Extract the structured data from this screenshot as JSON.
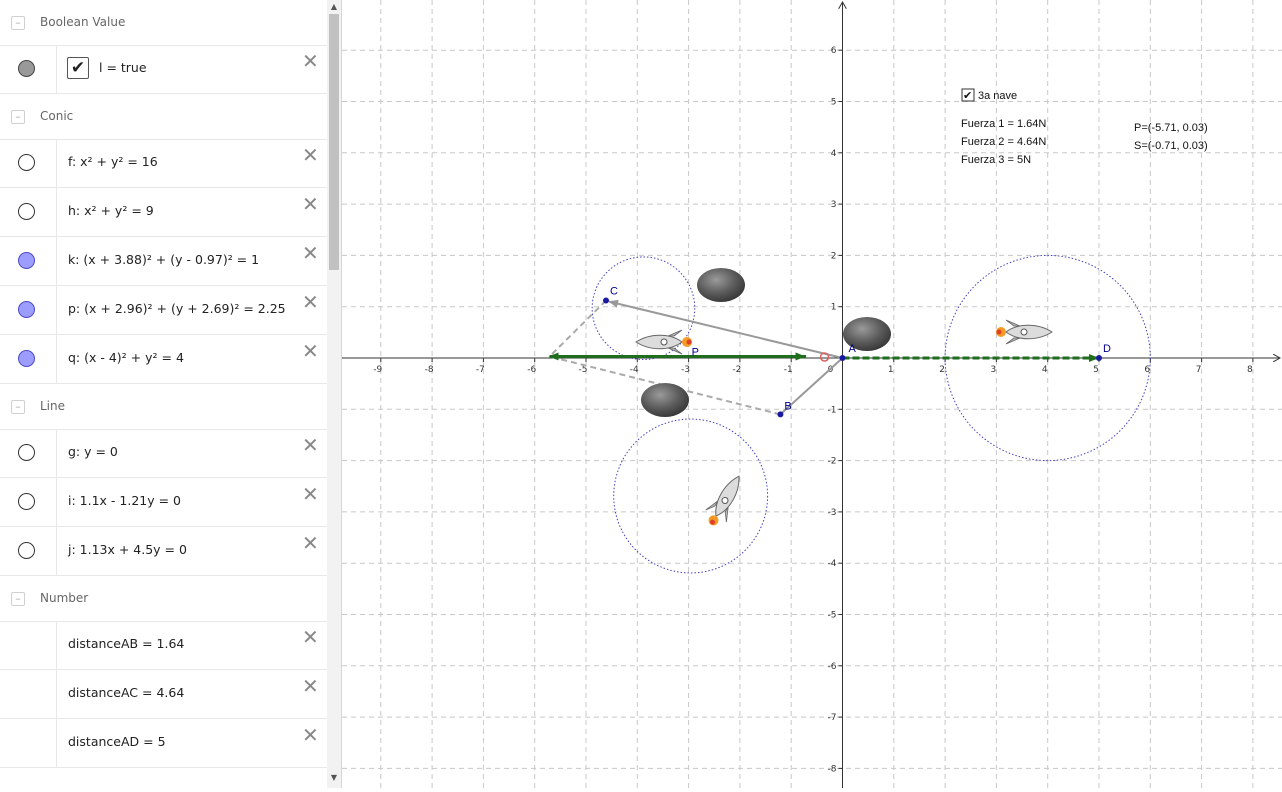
{
  "algebra": {
    "categories": [
      {
        "label": "Boolean Value",
        "top": 0
      },
      {
        "label": "Conic",
        "top": 94
      },
      {
        "label": "Line",
        "top": 384
      },
      {
        "label": "Number",
        "top": 576
      }
    ],
    "rows": [
      {
        "text": "l = true",
        "marker": "gray",
        "checkbox": true
      },
      {
        "text": "f: x² + y² = 16",
        "marker": "white"
      },
      {
        "text": "h: x² + y² = 9",
        "marker": "white"
      },
      {
        "text": "k: (x + 3.88)² + (y - 0.97)² = 1",
        "marker": "blue"
      },
      {
        "text": "p: (x + 2.96)² + (y + 2.69)² = 2.25",
        "marker": "blue"
      },
      {
        "text": "q: (x - 4)² + y² = 4",
        "marker": "blue"
      },
      {
        "text": "g: y = 0",
        "marker": "white"
      },
      {
        "text": "i: 1.1x - 1.21y = 0",
        "marker": "white"
      },
      {
        "text": "j: 1.13x + 4.5y = 0",
        "marker": "white"
      },
      {
        "text": "distanceAB = 1.64",
        "marker": "none"
      },
      {
        "text": "distanceAC = 4.64",
        "marker": "none"
      },
      {
        "text": "distanceAD = 5",
        "marker": "none"
      }
    ],
    "delete_glyph": "✕",
    "collapse_glyph": "–",
    "check_glyph": "✔"
  },
  "graphics": {
    "checkbox_label": "3a nave",
    "forces": [
      "Fuerza 1 = 1.64N",
      "Fuerza 2 = 4.64N",
      "Fuerza 3 = 5N"
    ],
    "coords": [
      "P=(-5.71, 0.03)",
      "S=(-0.71, 0.03)"
    ],
    "points": {
      "A": "A",
      "B": "B",
      "C": "C",
      "D": "D",
      "P": "P"
    },
    "x_ticks": [
      -9,
      -8,
      -7,
      -6,
      -5,
      -4,
      -3,
      -2,
      -1,
      0,
      1,
      2,
      3,
      4,
      5,
      6,
      7,
      8
    ],
    "y_ticks": [
      6,
      5,
      4,
      3,
      2,
      1,
      -1,
      -2,
      -3,
      -4,
      -5,
      -6,
      -7,
      -8
    ],
    "colors": {
      "vector_green": "#1e6e1e",
      "gray_vec": "#999999",
      "circle": "#4040c0",
      "point": "#1a1aa0"
    }
  }
}
